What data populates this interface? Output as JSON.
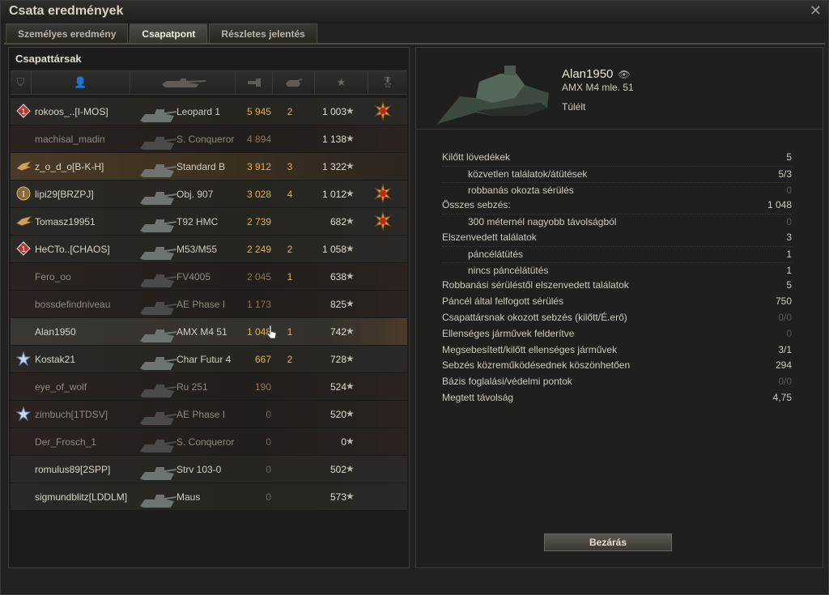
{
  "window": {
    "title": "Csata eredmények"
  },
  "tabs": [
    {
      "label": "Személyes eredmény"
    },
    {
      "label": "Csapatpont"
    },
    {
      "label": "Részletes jelentés"
    }
  ],
  "left": {
    "header": "Csapattársak"
  },
  "rows": [
    {
      "badge": "1",
      "name": "rokoos_..[I-MOS]",
      "vehicle": "Leopard 1",
      "damage": "5 945",
      "kills": "2",
      "xp": "1 003",
      "medal": true,
      "state": "alive"
    },
    {
      "badge": "",
      "name": "machisal_madin",
      "vehicle": "S. Conqueror",
      "damage": "4 894",
      "kills": "",
      "xp": "1 138",
      "medal": false,
      "state": "dead"
    },
    {
      "badge": "crest",
      "name": "z_o_d_o[B-K-H]",
      "vehicle": "Standard B",
      "damage": "3 912",
      "kills": "3",
      "xp": "1 322",
      "medal": false,
      "state": "orange"
    },
    {
      "badge": "I",
      "name": "lipi29[BRZPJ]",
      "vehicle": "Obj. 907",
      "damage": "3 028",
      "kills": "4",
      "xp": "1 012",
      "medal": true,
      "state": "alive"
    },
    {
      "badge": "crest",
      "name": "Tomasz19951",
      "vehicle": "T92 HMC",
      "damage": "2 739",
      "kills": "",
      "xp": "682",
      "medal": true,
      "state": "alive"
    },
    {
      "badge": "1",
      "name": "HeCTo..[CHAOS]",
      "vehicle": "M53/M55",
      "damage": "2 249",
      "kills": "2",
      "xp": "1 058",
      "medal": false,
      "state": "alive"
    },
    {
      "badge": "",
      "name": "Fero_oo",
      "vehicle": "FV4005",
      "damage": "2 045",
      "kills": "1",
      "xp": "638",
      "medal": false,
      "state": "dead"
    },
    {
      "badge": "",
      "name": "bossdefindniveau",
      "vehicle": "AE Phase I",
      "damage": "1 173",
      "kills": "",
      "xp": "825",
      "medal": false,
      "state": "dead"
    },
    {
      "badge": "",
      "name": "Alan1950",
      "vehicle": "AMX M4 51",
      "damage": "1 048",
      "kills": "1",
      "xp": "742",
      "medal": false,
      "state": "self"
    },
    {
      "badge": "star",
      "name": "Kostak21",
      "vehicle": "Char Futur 4",
      "damage": "667",
      "kills": "2",
      "xp": "728",
      "medal": false,
      "state": "alive"
    },
    {
      "badge": "",
      "name": "eye_of_wolf",
      "vehicle": "Ru 251",
      "damage": "190",
      "kills": "",
      "xp": "524",
      "medal": false,
      "state": "dead"
    },
    {
      "badge": "star",
      "name": "zimbuch[1TDSV]",
      "vehicle": "AE Phase I",
      "damage": "0",
      "kills": "",
      "xp": "520",
      "medal": false,
      "state": "dead"
    },
    {
      "badge": "",
      "name": "Der_Frosch_1",
      "vehicle": "S. Conqueror",
      "damage": "0",
      "kills": "",
      "xp": "0",
      "medal": false,
      "state": "dead"
    },
    {
      "badge": "",
      "name": "romulus89[2SPP]",
      "vehicle": "Strv 103-0",
      "damage": "0",
      "kills": "",
      "xp": "502",
      "medal": false,
      "state": "alive"
    },
    {
      "badge": "",
      "name": "sigmundblitz[LDDLM]",
      "vehicle": "Maus",
      "damage": "0",
      "kills": "",
      "xp": "573",
      "medal": false,
      "state": "alive"
    }
  ],
  "player": {
    "name": "Alan1950",
    "vehicle": "AMX M4 mle. 51",
    "status": "Túlélt"
  },
  "stats": [
    {
      "label": "Kilőtt lövedékek",
      "value": "5",
      "sub": false,
      "dim": false
    },
    {
      "label": "közvetlen találatok/átütések",
      "value": "5/3",
      "sub": true,
      "dim": false
    },
    {
      "label": "robbanás okozta sérülés",
      "value": "0",
      "sub": true,
      "dim": true
    },
    {
      "label": "Összes sebzés:",
      "value": "1 048",
      "sub": false,
      "dim": false
    },
    {
      "label": "300 méternél nagyobb távolságból",
      "value": "0",
      "sub": true,
      "dim": true
    },
    {
      "label": "Elszenvedett találatok",
      "value": "3",
      "sub": false,
      "dim": false
    },
    {
      "label": "páncélátütés",
      "value": "1",
      "sub": true,
      "dim": false
    },
    {
      "label": "nincs páncélátütés",
      "value": "1",
      "sub": true,
      "dim": false
    },
    {
      "label": "Robbanási sérüléstől elszenvedett találatok",
      "value": "5",
      "sub": false,
      "dim": false
    },
    {
      "label": "Páncél által felfogott sérülés",
      "value": "750",
      "sub": false,
      "dim": false
    },
    {
      "label": "Csapattársnak okozott sebzés (kilőtt/É.erő)",
      "value": "0/0",
      "sub": false,
      "dim": true
    },
    {
      "label": "Ellenséges járművek felderítve",
      "value": "0",
      "sub": false,
      "dim": true
    },
    {
      "label": "Megsebesített/kilőtt ellenséges járművek",
      "value": "3/1",
      "sub": false,
      "dim": false
    },
    {
      "label": "Sebzés közreműködésednek köszönhetően",
      "value": "294",
      "sub": false,
      "dim": false
    },
    {
      "label": "Bázis foglalási/védelmi pontok",
      "value": "0/0",
      "sub": false,
      "dim": true
    },
    {
      "label": "Megtett távolság",
      "value": "4,75",
      "sub": false,
      "dim": false
    }
  ],
  "buttons": {
    "close_label": "Bezárás"
  },
  "colors": {
    "accent": "#e3b24a",
    "bg": "#222220"
  }
}
